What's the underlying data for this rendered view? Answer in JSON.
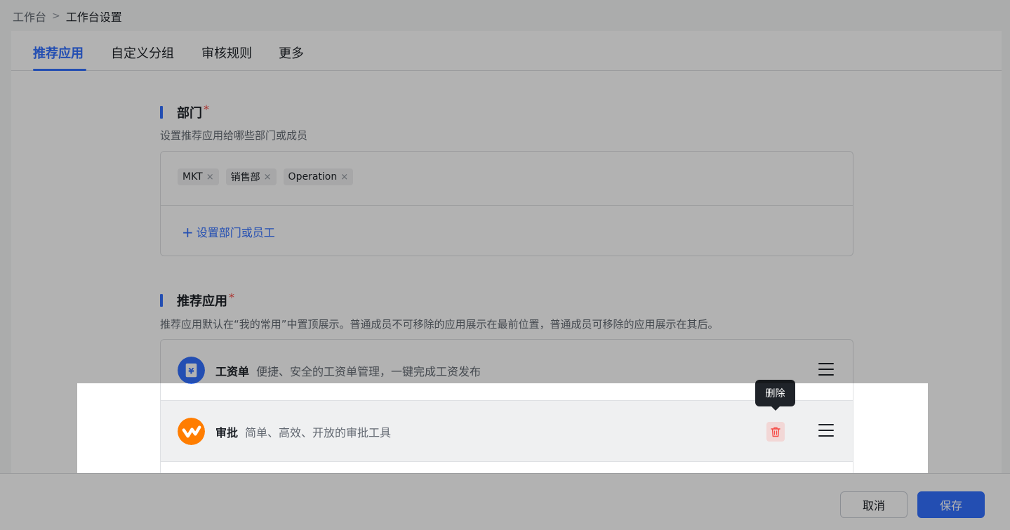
{
  "breadcrumb": {
    "root": "工作台",
    "separator": ">",
    "current": "工作台设置"
  },
  "tabs": [
    {
      "label": "推荐应用",
      "active": true
    },
    {
      "label": "自定义分组",
      "active": false
    },
    {
      "label": "审核规则",
      "active": false
    },
    {
      "label": "更多",
      "active": false
    }
  ],
  "department": {
    "title": "部门",
    "required_mark": "*",
    "description": "设置推荐应用给哪些部门或成员",
    "tags": [
      "MKT",
      "销售部",
      "Operation"
    ],
    "tag_remove_icon": "×",
    "add_link_plus": "+",
    "add_link": "设置部门或员工"
  },
  "recommended": {
    "title": "推荐应用",
    "required_mark": "*",
    "description": "推荐应用默认在“我的常用”中置顶展示。普通成员不可移除的应用展示在最前位置，普通成员可移除的应用展示在其后。",
    "apps": [
      {
        "name": "工资单",
        "description": "便捷、安全的工资单管理，一键完成工资发布",
        "icon": "payroll-icon",
        "icon_color": "#3370ff"
      },
      {
        "name": "审批",
        "description": "简单、高效、开放的审批工具",
        "icon": "approval-icon",
        "icon_color": "#ff7d00"
      }
    ],
    "delete_tooltip": "删除"
  },
  "footer": {
    "cancel_label": "取消",
    "save_label": "保存"
  },
  "colors": {
    "accent": "#3370ff",
    "danger": "#f54a45"
  }
}
